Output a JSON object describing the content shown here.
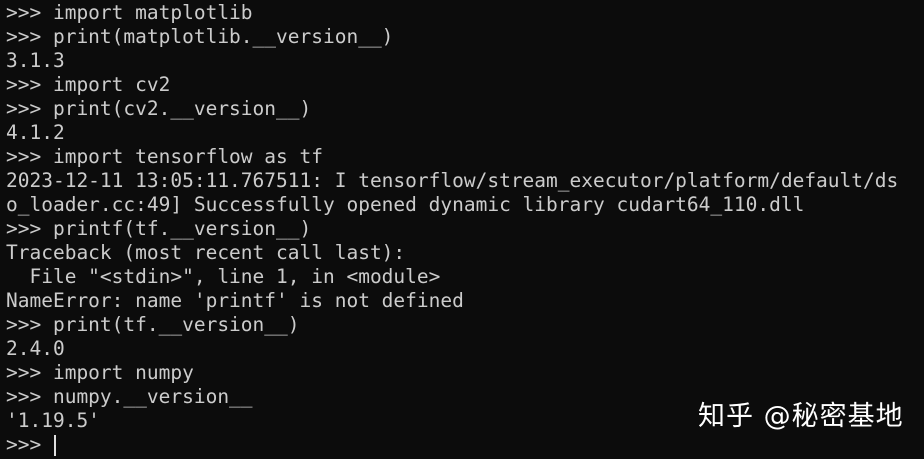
{
  "terminal": {
    "lines": [
      ">>> import matplotlib",
      ">>> print(matplotlib.__version__)",
      "3.1.3",
      ">>> import cv2",
      ">>> print(cv2.__version__)",
      "4.1.2",
      ">>> import tensorflow as tf",
      "2023-12-11 13:05:11.767511: I tensorflow/stream_executor/platform/default/ds",
      "o_loader.cc:49] Successfully opened dynamic library cudart64_110.dll",
      ">>> printf(tf.__version__)",
      "Traceback (most recent call last):",
      "  File \"<stdin>\", line 1, in <module>",
      "NameError: name 'printf' is not defined",
      ">>> print(tf.__version__)",
      "2.4.0",
      ">>> import numpy",
      ">>> numpy.__version__",
      "'1.19.5'"
    ],
    "current_prompt": ">>> "
  },
  "watermark": {
    "text": "知乎 @秘密基地"
  },
  "colors": {
    "background": "#0c0c0c",
    "foreground": "#cccccc",
    "watermark": "#ffffff"
  }
}
